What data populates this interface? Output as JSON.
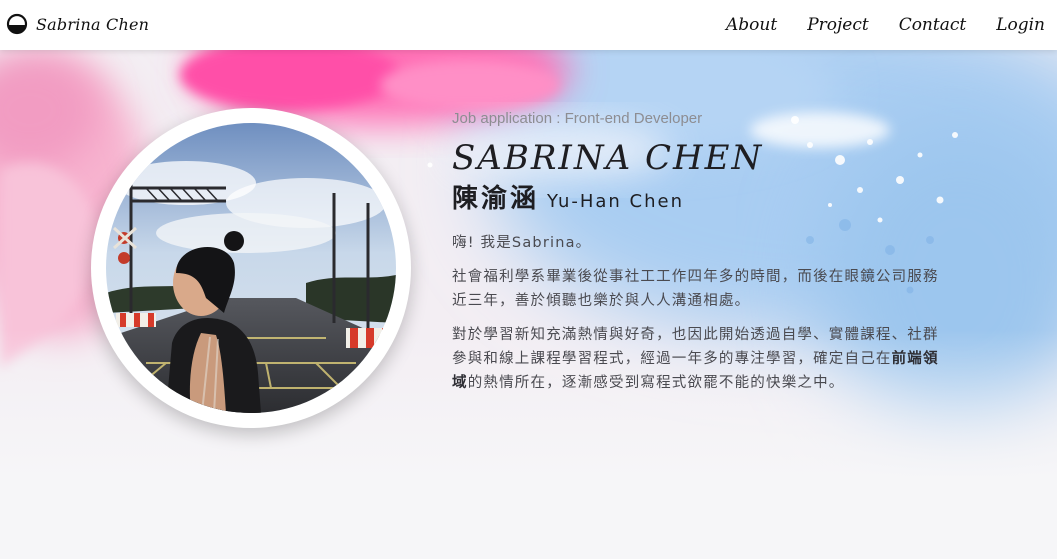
{
  "navbar": {
    "brand_icon": "half-moon-logo-icon",
    "brand_text": "Sabrina Chen",
    "links": [
      {
        "label": "About"
      },
      {
        "label": "Project"
      },
      {
        "label": "Contact"
      },
      {
        "label": "Login"
      }
    ]
  },
  "hero": {
    "job_title": "Job application : Front-end Developer",
    "name_en": "SABRINA CHEN",
    "name_zh": "陳渝涵",
    "name_alt": "Yu-Han Chen",
    "greeting": "嗨! 我是Sabrina。",
    "paragraph_2": "社會福利學系畢業後從事社工工作四年多的時間，而後在眼鏡公司服務近三年，善於傾聽也樂於與人人溝通相處。",
    "paragraph_3_before": "對於學習新知充滿熱情與好奇，也因此開始透過自學、實體課程、社群參與和線上課程學習程式，經過一年多的專注學習，確定自己在",
    "paragraph_3_bold": "前端領域",
    "paragraph_3_after": "的熱情所在，逐漸感受到寫程式欲罷不能的快樂之中。"
  },
  "colors": {
    "nav_background": "#ffffff",
    "text_dark": "#1e1e22",
    "text_muted": "#8d8d92",
    "text_body": "#4a4a50",
    "accent_pink": "#ff4fa8",
    "accent_blue": "#8fc2ef"
  }
}
